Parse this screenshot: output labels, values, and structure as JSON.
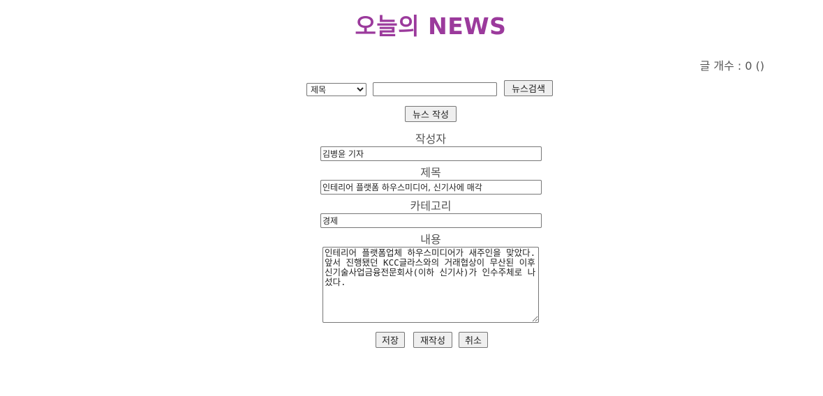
{
  "header": {
    "title": "오늘의 NEWS",
    "count_text": "글 개수 : 0 ()"
  },
  "search": {
    "select_value": "제목",
    "options": [
      "제목"
    ],
    "input_value": "",
    "button_label": "뉴스검색"
  },
  "actions": {
    "write_label": "뉴스 작성"
  },
  "form": {
    "author_label": "작성자",
    "author_value": "김병윤 기자",
    "title_label": "제목",
    "title_value": "인테리어 플랫폼 하우스미디어, 신기사에 매각",
    "category_label": "카테고리",
    "category_value": "경제",
    "content_label": "내용",
    "content_value": "인테리어 플랫폼업체 하우스미디어가 새주인을 맞았다. 앞서 진행됐던 KCC글라스와의 거래협상이 무산된 이후 신기술사업금융전문회사(이하 신기사)가 인수주체로 나섰다."
  },
  "buttons": {
    "save_label": "저장",
    "rewrite_label": "재작성",
    "cancel_label": "취소"
  },
  "colors": {
    "title": "#9b3a9c"
  }
}
